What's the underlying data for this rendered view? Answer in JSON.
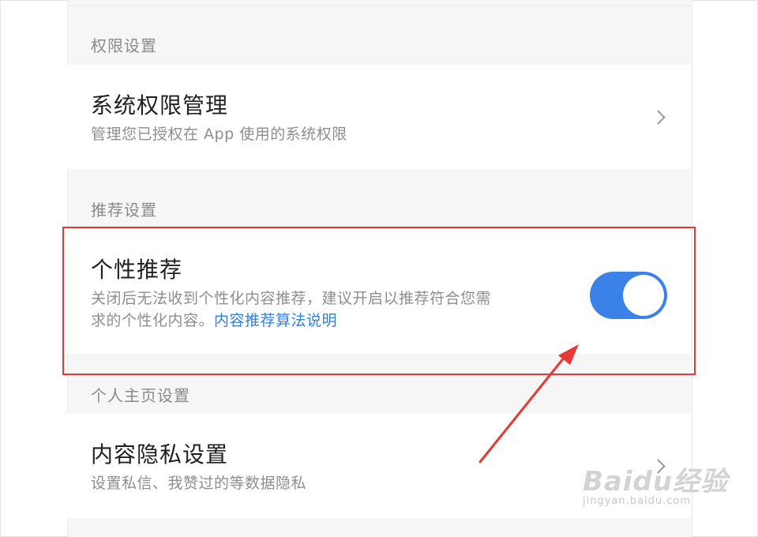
{
  "sections": {
    "permissions": {
      "header": "权限设置",
      "row": {
        "title": "系统权限管理",
        "subtitle": "管理您已授权在 App 使用的系统权限"
      }
    },
    "recommendation": {
      "header": "推荐设置",
      "row": {
        "title": "个性推荐",
        "subtitle_line1": "关闭后无法收到个性化内容推荐，建议开启以推荐符合您需",
        "subtitle_line2": "求的个性化内容。",
        "link": "内容推荐算法说明",
        "toggle_on": true
      }
    },
    "profile": {
      "header": "个人主页设置",
      "row": {
        "title": "内容隐私设置",
        "subtitle": "设置私信、我赞过的等数据隐私"
      }
    }
  },
  "watermark": {
    "main": "Baidu经验",
    "sub": "jingyan.baidu.com"
  },
  "colors": {
    "toggle_on": "#3a82e8",
    "link": "#2f7fe0",
    "highlight": "#e53935"
  }
}
